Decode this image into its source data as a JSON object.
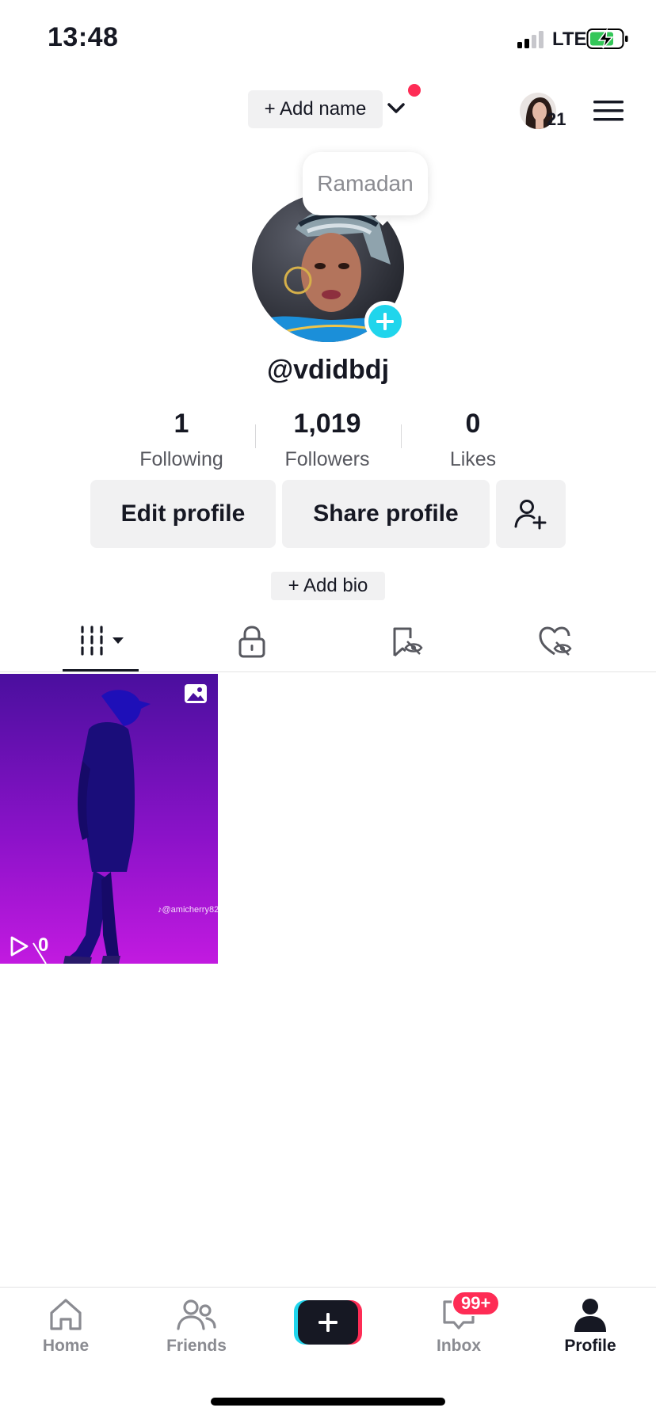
{
  "status_bar": {
    "time": "13:48",
    "network": "LTE",
    "battery_color": "#34c759"
  },
  "header": {
    "add_name_label": "+ Add name",
    "account_count": "21",
    "notification_color": "#fe2c55"
  },
  "profile": {
    "tooltip": "Ramadan",
    "username": "@vdidbdj",
    "stats": [
      {
        "value": "1",
        "label": "Following"
      },
      {
        "value": "1,019",
        "label": "Followers"
      },
      {
        "value": "0",
        "label": "Likes"
      }
    ],
    "edit_label": "Edit profile",
    "share_label": "Share profile",
    "add_bio_label": "+ Add bio"
  },
  "tabs": [
    {
      "icon": "videos-grid-icon",
      "active": true
    },
    {
      "icon": "lock-icon",
      "active": false
    },
    {
      "icon": "bookmark-hidden-icon",
      "active": false
    },
    {
      "icon": "heart-hidden-icon",
      "active": false
    }
  ],
  "videos": [
    {
      "views": "0",
      "watermark": "♪@amicherry82",
      "type": "photo"
    }
  ],
  "nav": {
    "home": "Home",
    "friends": "Friends",
    "inbox": "Inbox",
    "inbox_badge": "99+",
    "profile": "Profile"
  },
  "colors": {
    "accent": "#20d5ec",
    "brand_red": "#fe2c55",
    "text": "#161823"
  }
}
